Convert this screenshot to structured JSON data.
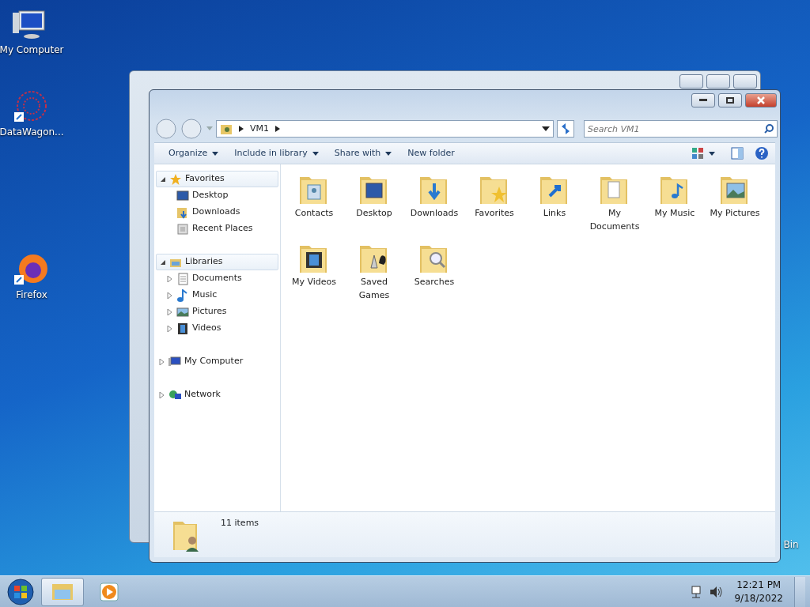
{
  "desktop_icons": [
    {
      "label": "My Computer",
      "kind": "computer"
    },
    {
      "label": "DataWagon...",
      "kind": "wagon"
    },
    {
      "label": "Firefox",
      "kind": "firefox"
    },
    {
      "label": "Bin",
      "kind": "bin"
    }
  ],
  "explorer": {
    "breadcrumb": [
      "VM1"
    ],
    "search": {
      "placeholder": "Search VM1"
    },
    "toolbar": [
      {
        "label": "Organize",
        "dropdown": true
      },
      {
        "label": "Include in library",
        "dropdown": true
      },
      {
        "label": "Share with",
        "dropdown": true
      },
      {
        "label": "New folder",
        "dropdown": false
      }
    ],
    "nav": [
      {
        "label": "Favorites",
        "kind": "star",
        "expanded": true,
        "highlighted": true,
        "children": [
          {
            "label": "Desktop",
            "kind": "desktop"
          },
          {
            "label": "Downloads",
            "kind": "downloads"
          },
          {
            "label": "Recent Places",
            "kind": "recent"
          }
        ]
      },
      {
        "label": "Libraries",
        "kind": "library",
        "expanded": true,
        "highlighted": true,
        "children": [
          {
            "label": "Documents",
            "kind": "documents",
            "expanded": false
          },
          {
            "label": "Music",
            "kind": "music",
            "expanded": false
          },
          {
            "label": "Pictures",
            "kind": "pictures",
            "expanded": false
          },
          {
            "label": "Videos",
            "kind": "videos",
            "expanded": false
          }
        ]
      },
      {
        "label": "My Computer",
        "kind": "computer",
        "expanded": false,
        "highlighted": false
      },
      {
        "label": "Network",
        "kind": "network",
        "expanded": false,
        "highlighted": false
      }
    ],
    "items": [
      {
        "label": "Contacts",
        "kind": "contacts"
      },
      {
        "label": "Desktop",
        "kind": "desktop"
      },
      {
        "label": "Downloads",
        "kind": "downloads"
      },
      {
        "label": "Favorites",
        "kind": "favorites"
      },
      {
        "label": "Links",
        "kind": "links"
      },
      {
        "label": "My Documents",
        "kind": "documents"
      },
      {
        "label": "My Music",
        "kind": "music"
      },
      {
        "label": "My Pictures",
        "kind": "pictures"
      },
      {
        "label": "My Videos",
        "kind": "videos"
      },
      {
        "label": "Saved Games",
        "kind": "games"
      },
      {
        "label": "Searches",
        "kind": "searches"
      }
    ],
    "status": "11 items"
  },
  "taskbar": {
    "apps": [
      {
        "kind": "explorer",
        "active": true
      },
      {
        "kind": "media",
        "active": false
      }
    ],
    "time": "12:21 PM",
    "date": "9/18/2022"
  }
}
